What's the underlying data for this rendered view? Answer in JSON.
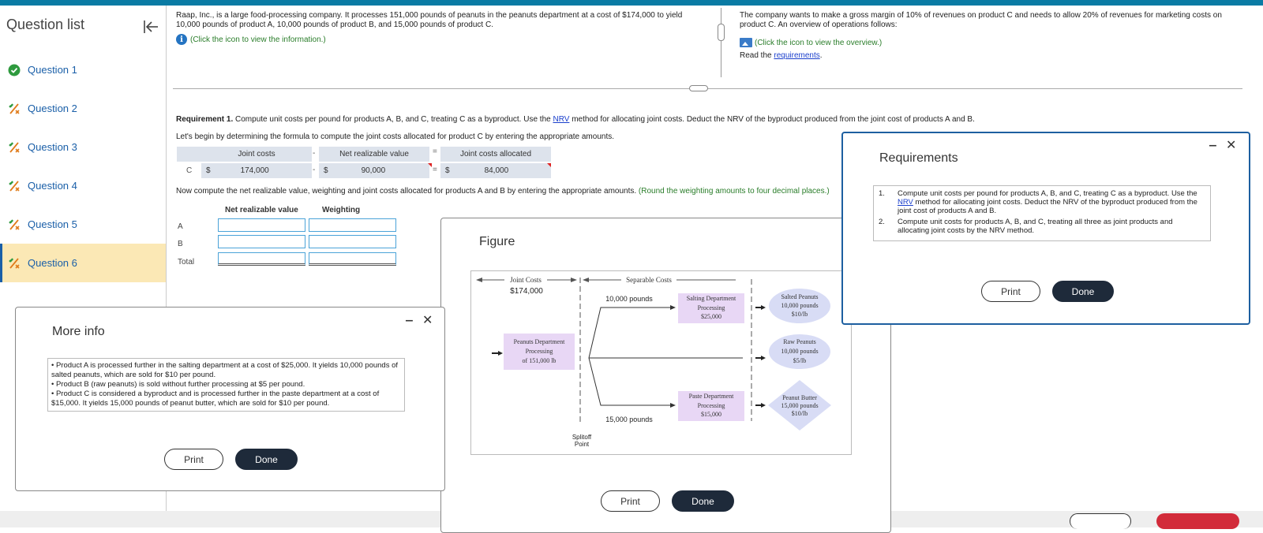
{
  "sidebar": {
    "title": "Question list",
    "items": [
      {
        "label": "Question 1",
        "status": "complete"
      },
      {
        "label": "Question 2",
        "status": "partial"
      },
      {
        "label": "Question 3",
        "status": "partial"
      },
      {
        "label": "Question 4",
        "status": "partial"
      },
      {
        "label": "Question 5",
        "status": "partial"
      },
      {
        "label": "Question 6",
        "status": "partial",
        "active": true
      }
    ]
  },
  "problem": {
    "intro": "Raap, Inc., is a large food-processing company. It processes 151,000 pounds of peanuts in the peanuts department at a cost of $174,000 to yield 10,000 pounds of product A, 10,000 pounds of product B, and 15,000 pounds of product C.",
    "info_link": "(Click the icon to view the information.)",
    "right_intro": "The company wants to make a gross margin of 10% of revenues on product C and needs to allow 20% of revenues for marketing costs on product C. An overview of operations follows:",
    "overview_link": "(Click the icon to view the overview.)",
    "read_prefix": "Read the ",
    "read_link": "requirements",
    "read_suffix": "."
  },
  "requirement1": {
    "label": "Requirement 1.",
    "text_a": " Compute unit costs per pound for products A, B, and C, treating C as a byproduct. Use the ",
    "nrv": "NRV",
    "text_b": " method for allocating joint costs. Deduct the NRV of the byproduct produced from the joint cost of products A and B.",
    "begin": "Let's begin by determining the formula to compute the joint costs allocated for product C by entering the appropriate amounts."
  },
  "formula": {
    "row_label": "C",
    "h1": "Joint costs",
    "h2": "Net realizable value",
    "h3": "Joint costs allocated",
    "minus": "-",
    "equals": "=",
    "dollar": "$",
    "v1": "174,000",
    "v2": "90,000",
    "v3": "84,000"
  },
  "nrv_table": {
    "instruction": "Now compute the net realizable value, weighting and joint costs allocated for products A and B by entering the appropriate amounts. ",
    "hint": "(Round the weighting amounts to four decimal places.)",
    "col1": "Net realizable value",
    "col2": "Weighting",
    "rows": [
      "A",
      "B",
      "Total"
    ]
  },
  "more_info": {
    "title": "More info",
    "bullets": [
      "• Product A is processed further in the salting department at a cost of $25,000. It yields 10,000 pounds of salted peanuts, which are sold for $10 per pound.",
      "• Product B (raw peanuts) is sold without further processing at $5 per pound.",
      "• Product C is considered a byproduct and is processed further in the paste department at a cost of $15,000. It yields 15,000 pounds of peanut butter,  which are sold for $10 per pound."
    ],
    "print": "Print",
    "done": "Done"
  },
  "figure": {
    "title": "Figure",
    "joint_costs": "Joint Costs",
    "joint_amount": "$174,000",
    "separable_costs": "Separable Costs",
    "peanuts_dept": [
      "Peanuts Department",
      "Processing",
      "of 151,000 lb"
    ],
    "top_pounds": "10,000 pounds",
    "bottom_pounds": "15,000 pounds",
    "salting": [
      "Salting Department",
      "Processing",
      "$25,000"
    ],
    "paste": [
      "Paste Department",
      "Processing",
      "$15,000"
    ],
    "salted": [
      "Salted Peanuts",
      "10,000 pounds",
      "$10/lb"
    ],
    "raw": [
      "Raw Peanuts",
      "10,000 pounds",
      "$5/lb"
    ],
    "butter": [
      "Peanut Butter",
      "15,000 pounds",
      "$10/lb"
    ],
    "splitoff": [
      "Splitoff",
      "Point"
    ],
    "print": "Print",
    "done": "Done"
  },
  "requirements": {
    "title": "Requirements",
    "items": [
      {
        "num": "1.",
        "a": "Compute unit costs per pound for products A, B, and C, treating C as a byproduct. Use the ",
        "link": "NRV",
        "b": " method for allocating joint costs. Deduct the NRV of the byproduct produced from the joint cost of products A and B."
      },
      {
        "num": "2.",
        "a": "Compute unit costs for products A, B, and C, treating all three as joint products and allocating joint costs by the NRV method.",
        "link": "",
        "b": ""
      }
    ],
    "print": "Print",
    "done": "Done"
  },
  "colors": {
    "accent": "#0a7ba4",
    "link": "#1a3fcc",
    "hint_green": "#2a7d2a",
    "active_bg": "#fbe8b5",
    "diagram_fill": "#e8d7f5",
    "product_fill": "#d8dcf5"
  }
}
